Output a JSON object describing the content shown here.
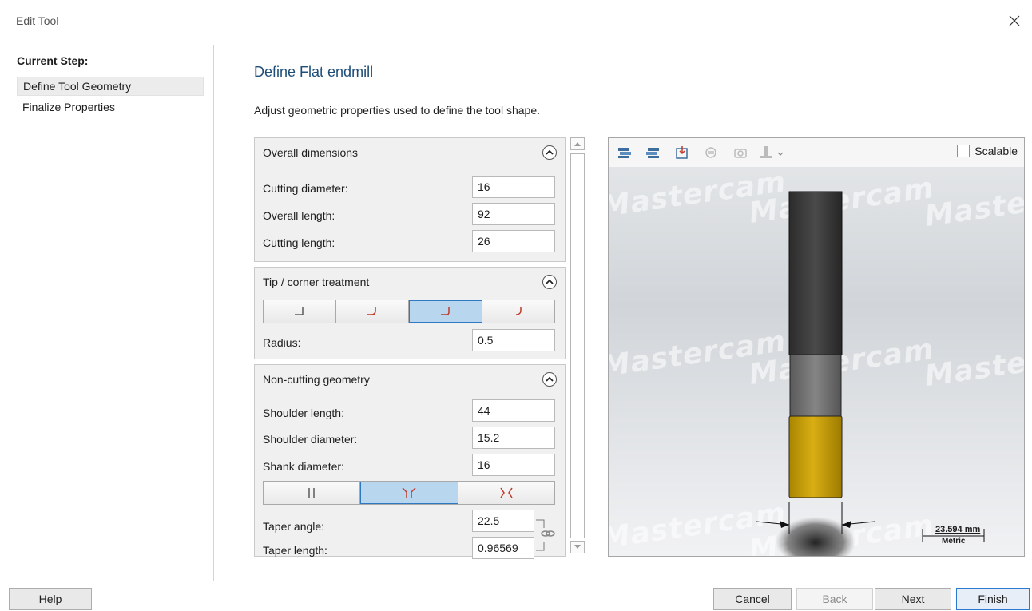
{
  "window": {
    "title": "Edit Tool"
  },
  "sidebar": {
    "heading": "Current Step:",
    "steps": [
      {
        "label": "Define Tool Geometry",
        "active": true
      },
      {
        "label": "Finalize Properties",
        "active": false
      }
    ]
  },
  "main": {
    "title": "Define Flat endmill",
    "subtitle": "Adjust geometric properties used to define the tool shape."
  },
  "overall_dimensions": {
    "heading": "Overall dimensions",
    "cutting_diameter_label": "Cutting diameter:",
    "cutting_diameter": "16",
    "overall_length_label": "Overall length:",
    "overall_length": "92",
    "cutting_length_label": "Cutting length:",
    "cutting_length": "26"
  },
  "tip_corner": {
    "heading": "Tip / corner treatment",
    "selected_option": 3,
    "radius_label": "Radius:",
    "radius": "0.5"
  },
  "non_cutting": {
    "heading": "Non-cutting geometry",
    "shoulder_length_label": "Shoulder length:",
    "shoulder_length": "44",
    "shoulder_diameter_label": "Shoulder diameter:",
    "shoulder_diameter": "15.2",
    "shank_diameter_label": "Shank diameter:",
    "shank_diameter": "16",
    "selected_option": 2,
    "taper_angle_label": "Taper angle:",
    "taper_angle": "22.5",
    "taper_length_label": "Taper length:",
    "taper_length": "0.96569"
  },
  "preview": {
    "scalable_label": "Scalable",
    "scalable_checked": false,
    "watermark": "Mastercam",
    "scale_value": "23.594 mm",
    "scale_unit": "Metric",
    "colors": {
      "shank": "#3a3a3a",
      "shoulder": "#6e6e6e",
      "flute": "#c9a000"
    }
  },
  "buttons": {
    "help": "Help",
    "cancel": "Cancel",
    "back": "Back",
    "next": "Next",
    "finish": "Finish"
  }
}
